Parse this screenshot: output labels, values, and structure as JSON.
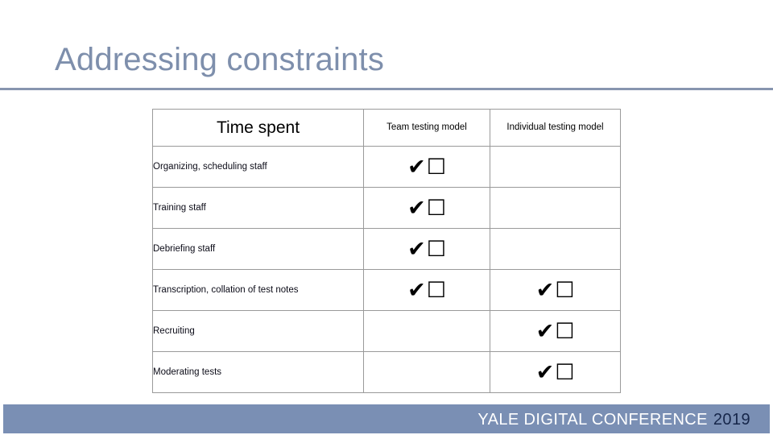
{
  "slide": {
    "title": "Addressing constraints"
  },
  "table": {
    "columns": [
      {
        "key": "task",
        "label": "Time spent",
        "style": "main"
      },
      {
        "key": "team",
        "label": "Team testing model",
        "style": "sub"
      },
      {
        "key": "indiv",
        "label": "Individual testing model",
        "style": "sub"
      }
    ],
    "mark_glyphs": {
      "check": "✔",
      "box": "☐"
    },
    "rows": [
      {
        "task": "Organizing, scheduling staff",
        "shaded": true,
        "team": true,
        "indiv": false
      },
      {
        "task": "Training staff",
        "shaded": false,
        "team": true,
        "indiv": false
      },
      {
        "task": "Debriefing staff",
        "shaded": true,
        "team": true,
        "indiv": false
      },
      {
        "task": "Transcription, collation of test notes",
        "shaded": false,
        "team": true,
        "indiv": true
      },
      {
        "task": "Recruiting",
        "shaded": true,
        "team": false,
        "indiv": true
      },
      {
        "task": "Moderating tests",
        "shaded": false,
        "team": false,
        "indiv": true
      }
    ]
  },
  "footer": {
    "brand_name": "YALE DIGITAL CONFERENCE",
    "brand_year": "2019"
  },
  "colors": {
    "title_text": "#7E8FAC",
    "rule": "#8795AF",
    "row_shade": "#A3C1F0",
    "footer_bar": "#7A8FB4",
    "footer_year": "#16264a",
    "table_border": "#9a9a9a"
  }
}
